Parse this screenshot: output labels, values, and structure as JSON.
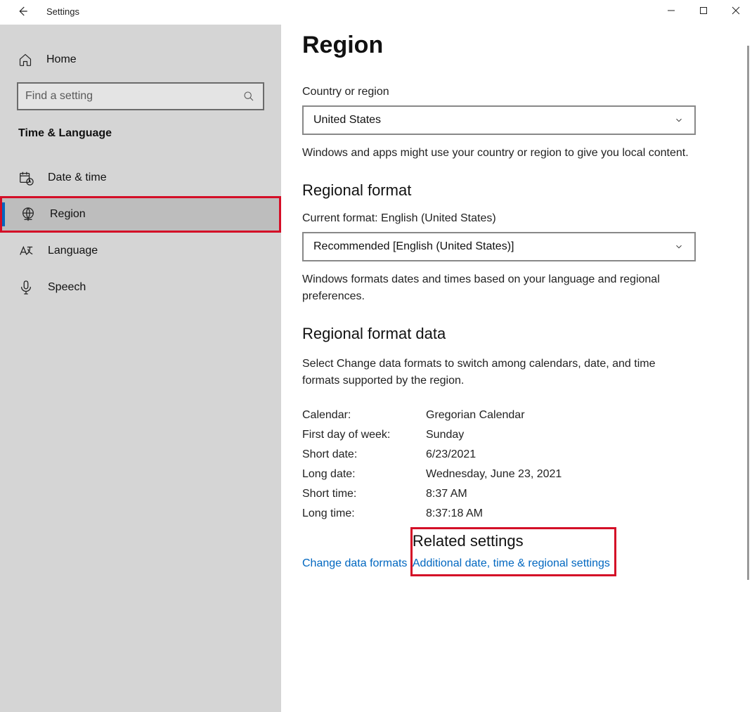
{
  "window": {
    "title": "Settings"
  },
  "sidebar": {
    "home": "Home",
    "search_placeholder": "Find a setting",
    "section": "Time & Language",
    "items": [
      {
        "label": "Date & time"
      },
      {
        "label": "Region"
      },
      {
        "label": "Language"
      },
      {
        "label": "Speech"
      }
    ]
  },
  "page": {
    "title": "Region",
    "country_label": "Country or region",
    "country_value": "United States",
    "country_desc": "Windows and apps might use your country or region to give you local content.",
    "rf_heading": "Regional format",
    "rf_current": "Current format: English (United States)",
    "rf_value": "Recommended [English (United States)]",
    "rf_desc": "Windows formats dates and times based on your language and regional preferences.",
    "rfd_heading": "Regional format data",
    "rfd_desc": "Select Change data formats to switch among calendars, date, and time formats supported by the region.",
    "data": [
      {
        "k": "Calendar:",
        "v": "Gregorian Calendar"
      },
      {
        "k": "First day of week:",
        "v": "Sunday"
      },
      {
        "k": "Short date:",
        "v": "6/23/2021"
      },
      {
        "k": "Long date:",
        "v": "Wednesday, June 23, 2021"
      },
      {
        "k": "Short time:",
        "v": "8:37 AM"
      },
      {
        "k": "Long time:",
        "v": "8:37:18 AM"
      }
    ],
    "change_link": "Change data formats",
    "related_heading": "Related settings",
    "related_link": "Additional date, time & regional settings"
  }
}
